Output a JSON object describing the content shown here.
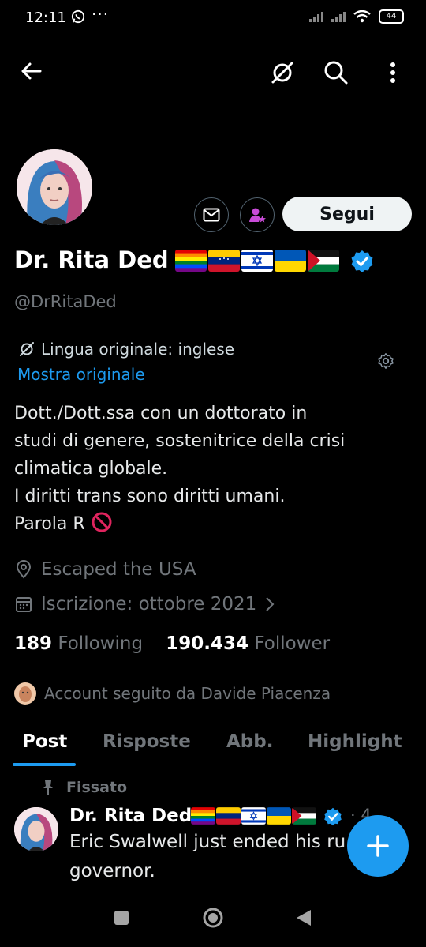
{
  "status_bar": {
    "time": "12:11",
    "battery": "44"
  },
  "profile": {
    "name": "Dr. Rita Ded",
    "handle": "@DrRitaDed",
    "follow_button": "Segui",
    "translation": {
      "label": "Lingua originale: inglese",
      "show_original": "Mostra originale"
    },
    "bio": [
      "Dott./Dott.ssa con un dottorato in",
      "studi di genere, sostenitrice della crisi",
      "climatica globale.",
      "I diritti trans sono diritti umani.",
      "Parola R"
    ],
    "location": "Escaped the USA",
    "joined": "Iscrizione: ottobre 2021",
    "following_count": "189",
    "following_label": "Following",
    "followers_count": "190.434",
    "followers_label": "Follower",
    "followed_by": "Account seguito da Davide Piacenza"
  },
  "tabs": [
    "Post",
    "Risposte",
    "Abb.",
    "Highlight"
  ],
  "pinned_post": {
    "pinned_label": "Fissato",
    "author": "Dr. Rita Ded",
    "time": "· 4",
    "text": [
      "Eric Swalwell just ended his ru",
      "governor."
    ]
  },
  "icons": [
    "back-arrow-icon",
    "translate-icon",
    "search-icon",
    "more-vertical-icon",
    "message-icon",
    "subscribe-icon",
    "verified-badge-icon",
    "location-icon",
    "calendar-icon",
    "chevron-right-icon",
    "pin-icon",
    "plus-icon",
    "settings-gear-icon",
    "no-entry-icon"
  ],
  "colors": {
    "accent": "#1d9bf0",
    "background": "#000000",
    "muted": "#71767b",
    "subscribe": "#c94bd8"
  }
}
